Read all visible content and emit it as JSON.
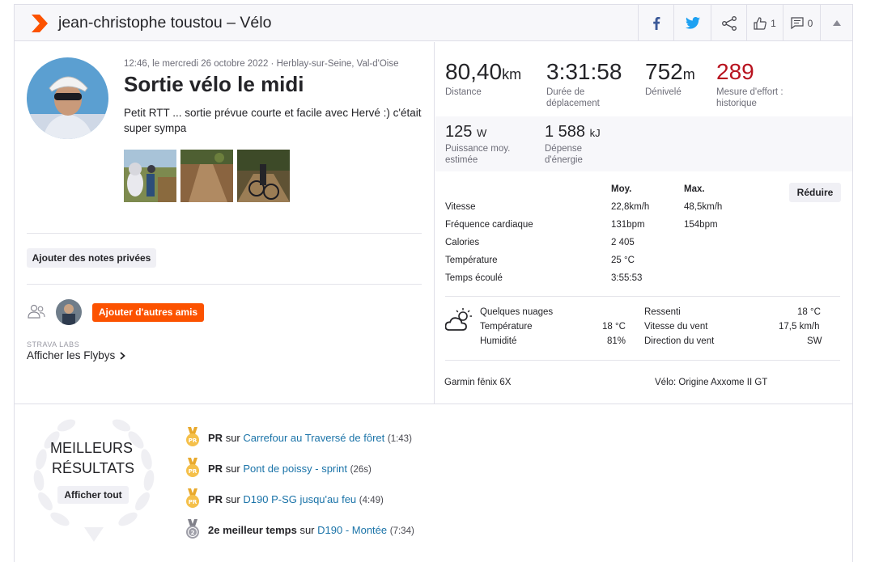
{
  "header": {
    "title": "jean-christophe toustou – Vélo",
    "kudos_count": "1",
    "comments_count": "0"
  },
  "activity": {
    "meta": "12:46, le mercredi 26 octobre 2022 · Herblay-sur-Seine, Val-d'Oise",
    "title": "Sortie vélo le midi",
    "description": "Petit RTT ... sortie prévue courte et facile avec Hervé :) c'était super sympa"
  },
  "private_notes_button": "Ajouter des notes privées",
  "add_friends_button": "Ajouter d'autres amis",
  "labs": {
    "label": "STRAVA LABS",
    "flyby_link": "Afficher les Flybys"
  },
  "stats": {
    "distance": {
      "value": "80,40",
      "unit": "km",
      "label": "Distance"
    },
    "moving_time": {
      "value": "3:31:58",
      "label": "Durée de déplacement"
    },
    "elevation": {
      "value": "752",
      "unit": "m",
      "label": "Dénivelé"
    },
    "effort": {
      "value": "289",
      "label": "Mesure d'effort : historique"
    },
    "power": {
      "value": "125",
      "unit": "W",
      "label": "Puissance moy. estimée"
    },
    "energy": {
      "value": "1 588",
      "unit": "kJ",
      "label": "Dépense d'énergie"
    }
  },
  "details": {
    "col_avg": "Moy.",
    "col_max": "Max.",
    "collapse_button": "Réduire",
    "rows": [
      {
        "label": "Vitesse",
        "avg": "22,8km/h",
        "max": "48,5km/h"
      },
      {
        "label": "Fréquence cardiaque",
        "avg": "131bpm",
        "max": "154bpm"
      },
      {
        "label": "Calories",
        "avg": "2 405",
        "max": ""
      },
      {
        "label": "Température",
        "avg": "25 °C",
        "max": ""
      },
      {
        "label": "Temps écoulé",
        "avg": "3:55:53",
        "max": ""
      }
    ]
  },
  "weather": {
    "condition": "Quelques nuages",
    "temp_label": "Température",
    "temp": "18 °C",
    "humidity_label": "Humidité",
    "humidity": "81%",
    "feels_label": "Ressenti",
    "feels": "18 °C",
    "wind_speed_label": "Vitesse du vent",
    "wind_speed": "17,5 km/h",
    "wind_dir_label": "Direction du vent",
    "wind_dir": "SW"
  },
  "device": "Garmin fēnix 6X",
  "bike": "Vélo: Origine Axxome II GT",
  "best": {
    "line1": "MEILLEURS",
    "line2": "RÉSULTATS",
    "show_all": "Afficher tout",
    "items": [
      {
        "rank": "PR",
        "sep": "sur",
        "segment": "Carrefour au Traversé de fôret",
        "time": "(1:43)"
      },
      {
        "rank": "PR",
        "sep": "sur",
        "segment": "Pont de poissy - sprint",
        "time": "(26s)"
      },
      {
        "rank": "PR",
        "sep": "sur",
        "segment": "D190 P-SG jusqu'au feu",
        "time": "(4:49)"
      },
      {
        "rank": "2e meilleur temps",
        "sep": "sur",
        "segment": "D190 - Montée",
        "time": "(7:34)"
      }
    ]
  },
  "colors": {
    "accent": "#fc5200",
    "effort": "#b8131f",
    "link": "#1a73a8",
    "gold": "#f5c04a",
    "silver": "#9e9ea8"
  }
}
